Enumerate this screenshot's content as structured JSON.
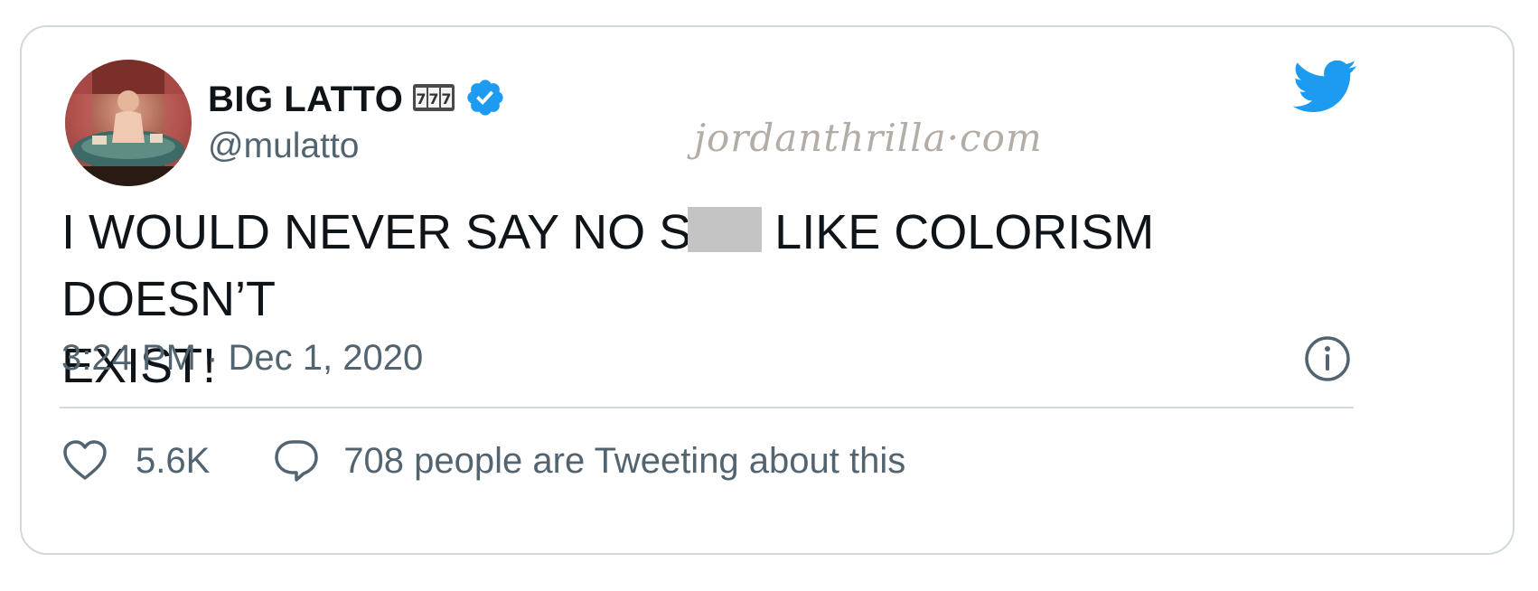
{
  "tweet": {
    "author_name": "BIG LATTO",
    "author_emoji": "777",
    "verified_badge_icon": "verified-check-icon",
    "handle": "@mulatto",
    "text_line1_before": "I WOULD NEVER SAY NO S",
    "text_line1_after": "LIKE COLORISM DOESN’T",
    "text_line2": "EXIST!",
    "timestamp": "3:24 PM · Dec 1, 2020",
    "likes": "5.6K",
    "people_tweeting": "708 people are Tweeting about this"
  },
  "watermark": "jordanthrilla·com",
  "icons": {
    "brand": "twitter-bird-icon",
    "info": "info-icon",
    "like": "heart-icon",
    "reply": "speech-bubble-icon"
  },
  "colors": {
    "accent": "#1d9bf0",
    "text": "#0f1419",
    "secondary": "#536471",
    "border": "#cfd9de"
  }
}
